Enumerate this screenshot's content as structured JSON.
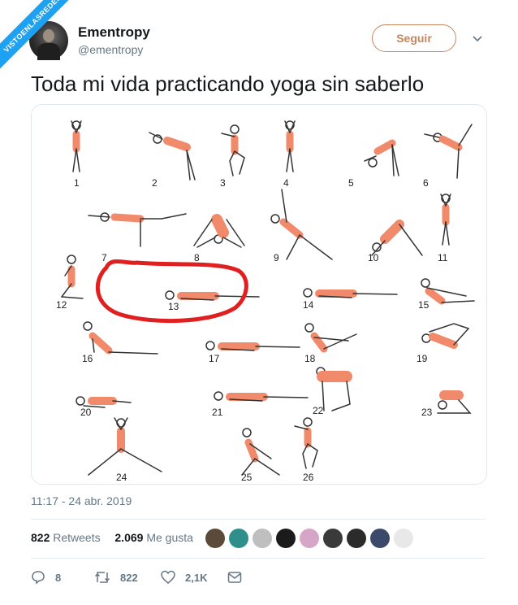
{
  "banner": {
    "text": "VISTOENLASREDES",
    "color": "#1da1f2"
  },
  "author": {
    "name": "Ementropy",
    "handle": "@ementropy"
  },
  "follow_label": "Seguir",
  "tweet_text": "Toda mi vida practicando yoga sin saberlo",
  "image": {
    "pose_numbers": [
      "1",
      "2",
      "3",
      "4",
      "5",
      "6",
      "7",
      "8",
      "9",
      "10",
      "11",
      "12",
      "13",
      "14",
      "15",
      "16",
      "17",
      "18",
      "19",
      "20",
      "21",
      "22",
      "23",
      "24",
      "25",
      "26"
    ],
    "highlighted_pose": "13",
    "highlight_color": "#e02020",
    "figure_color": "#f08a6a"
  },
  "timestamp": "11:17 - 24 abr. 2019",
  "stats": {
    "retweets_count": "822",
    "retweets_label": "Retweets",
    "likes_count": "2.069",
    "likes_label": "Me gusta"
  },
  "liker_avatars": [
    "#5b4a3a",
    "#2f8f8a",
    "#bfbfbf",
    "#1b1b1b",
    "#d6a6c7",
    "#3a3a3a",
    "#2b2b2b",
    "#3b4a6b",
    "#e8e8e8"
  ],
  "actions": {
    "replies": "8",
    "retweets": "822",
    "likes": "2,1K"
  },
  "icons": {
    "reply": "reply-icon",
    "retweet": "retweet-icon",
    "like": "heart-icon",
    "dm": "envelope-icon",
    "more": "chevron-down-icon"
  }
}
